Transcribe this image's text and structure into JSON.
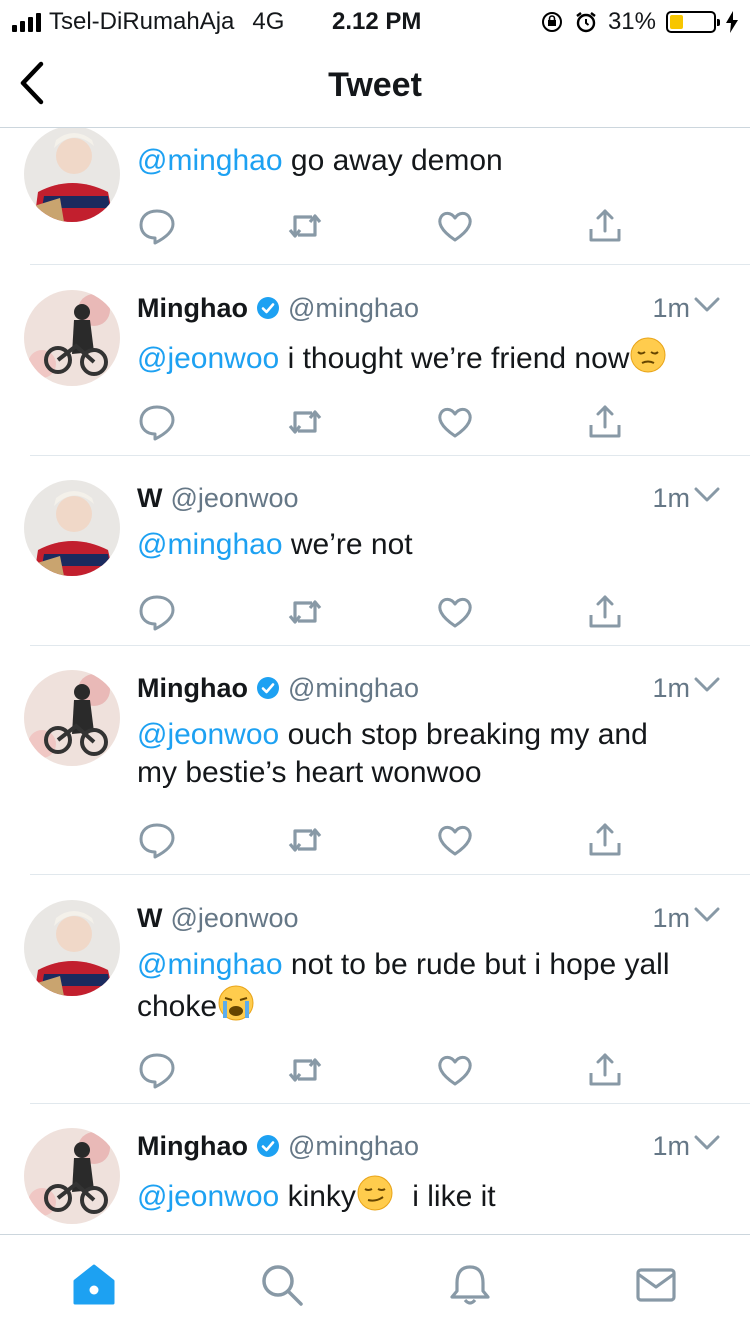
{
  "status_bar": {
    "carrier": "Tsel-DiRumahAja",
    "network": "4G",
    "time": "2.12 PM",
    "battery_percent": "31%",
    "battery_level": 0.31
  },
  "nav": {
    "title": "Tweet"
  },
  "tweets": [
    {
      "name": "",
      "handle": "",
      "time": "",
      "mention": "@minghao",
      "text": "go away demon"
    },
    {
      "name": "Minghao",
      "handle": "@minghao",
      "time": "1m",
      "mention": "@jeonwoo",
      "text": "i thought we’re friend now"
    },
    {
      "name": "W",
      "handle": "@jeonwoo",
      "time": "1m",
      "mention": "@minghao",
      "text": "we’re not"
    },
    {
      "name": "Minghao",
      "handle": "@minghao",
      "time": "1m",
      "mention": "@jeonwoo",
      "text": "ouch stop breaking my and",
      "text2": "my bestie’s heart wonwoo"
    },
    {
      "name": "W",
      "handle": "@jeonwoo",
      "time": "1m",
      "mention": "@minghao",
      "text": "not to be rude but i hope yall",
      "text2": "choke"
    },
    {
      "name": "Minghao",
      "handle": "@minghao",
      "time": "1m",
      "mention": "@jeonwoo",
      "text": "kinky",
      "text_after": "i like it"
    }
  ],
  "colors": {
    "accent": "#1da1f2",
    "muted": "#657786",
    "divider": "#e1e8ed"
  },
  "icons": [
    "back-chevron-icon",
    "reply-icon",
    "retweet-icon",
    "like-icon",
    "share-icon",
    "home-icon",
    "search-icon",
    "notifications-icon",
    "messages-icon"
  ]
}
